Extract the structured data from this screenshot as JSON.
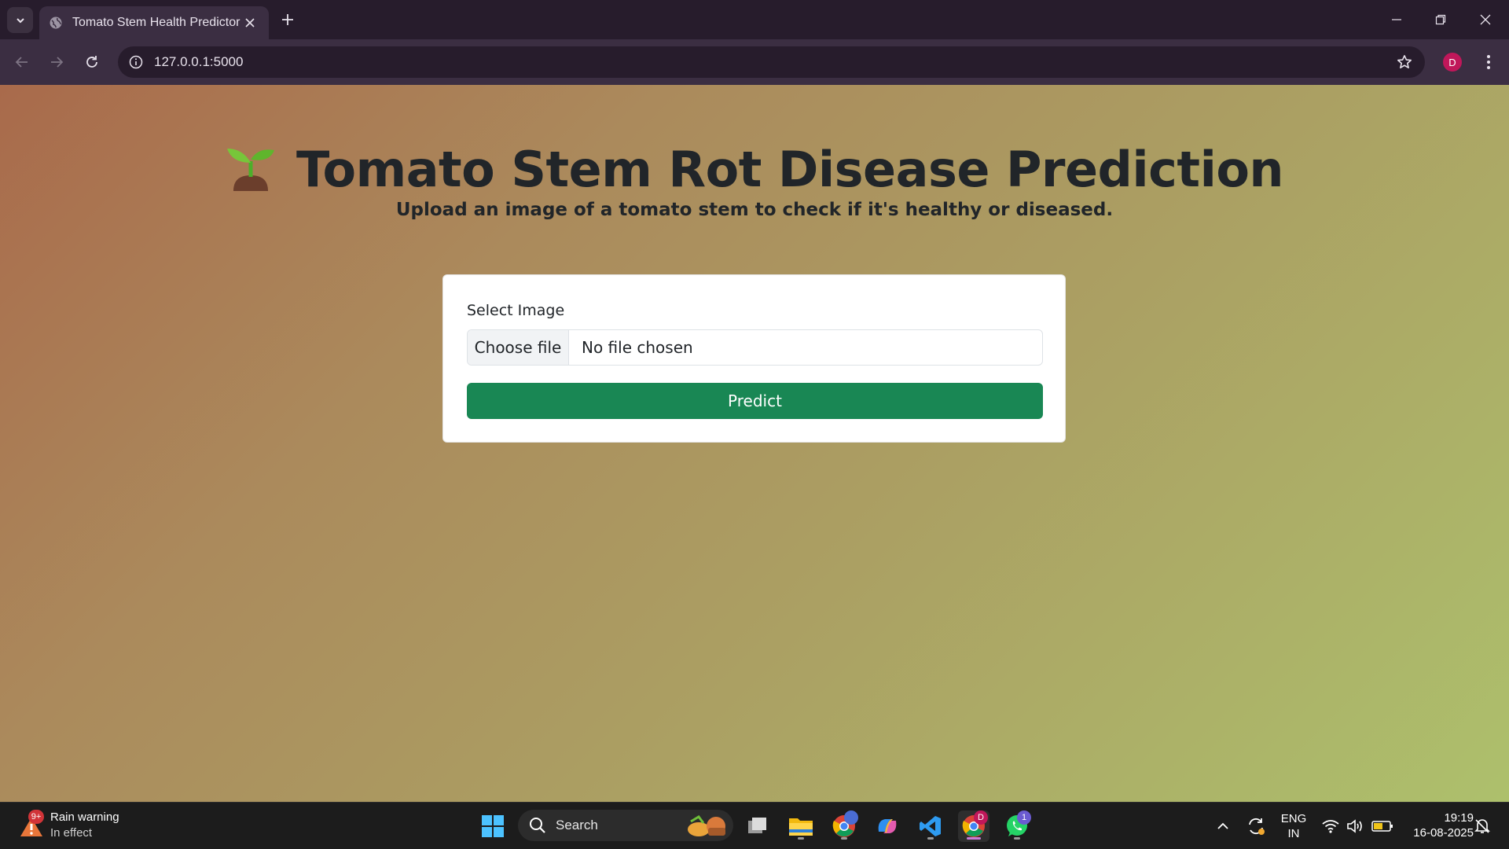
{
  "browser": {
    "tab_title": "Tomato Stem Health Predictor",
    "url": "127.0.0.1:5000",
    "profile_initial": "D"
  },
  "page": {
    "title": "Tomato Stem Rot Disease Prediction",
    "subtitle": "Upload an image of a tomato stem to check if it's healthy or diseased.",
    "form": {
      "label": "Select Image",
      "choose_file_label": "Choose file",
      "file_status": "No file chosen",
      "submit_label": "Predict"
    },
    "colors": {
      "primary_button": "#198754",
      "text": "#212529"
    }
  },
  "taskbar": {
    "weather": {
      "badge": "9+",
      "title": "Rain warning",
      "subtitle": "In effect"
    },
    "search_label": "Search",
    "chrome_badge": "D",
    "whatsapp_badge": "1",
    "language": "ENG",
    "region": "IN",
    "time": "19:19",
    "date": "16-08-2025"
  }
}
